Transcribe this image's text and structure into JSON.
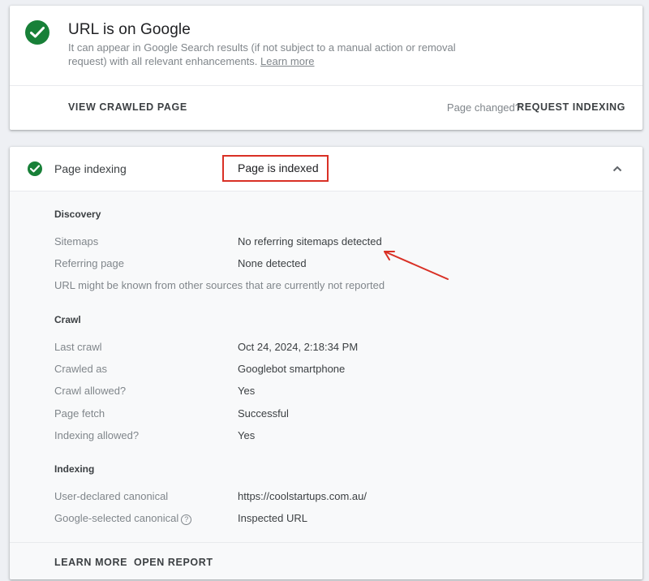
{
  "status_card": {
    "title": "URL is on Google",
    "description": "It can appear in Google Search results (if not subject to a manual action or removal request) with all relevant enhancements.",
    "learn_more_link": "Learn more",
    "view_crawled_label": "VIEW CRAWLED PAGE",
    "page_changed_label": "Page changed?",
    "request_indexing_label": "REQUEST INDEXING"
  },
  "indexing_card": {
    "title": "Page indexing",
    "status": "Page is indexed",
    "discovery": {
      "heading": "Discovery",
      "sitemaps_label": "Sitemaps",
      "sitemaps_value": "No referring sitemaps detected",
      "referring_label": "Referring page",
      "referring_value": "None detected",
      "note": "URL might be known from other sources that are currently not reported"
    },
    "crawl": {
      "heading": "Crawl",
      "last_crawl_label": "Last crawl",
      "last_crawl_value": "Oct 24, 2024, 2:18:34 PM",
      "crawled_as_label": "Crawled as",
      "crawled_as_value": "Googlebot smartphone",
      "crawl_allowed_label": "Crawl allowed?",
      "crawl_allowed_value": "Yes",
      "page_fetch_label": "Page fetch",
      "page_fetch_value": "Successful",
      "indexing_allowed_label": "Indexing allowed?",
      "indexing_allowed_value": "Yes"
    },
    "indexing": {
      "heading": "Indexing",
      "user_canonical_label": "User-declared canonical",
      "user_canonical_value": "https://coolstartups.com.au/",
      "google_canonical_label": "Google-selected canonical",
      "google_canonical_value": "Inspected URL",
      "help_glyph": "?"
    },
    "learn_more_label": "LEARN MORE",
    "open_report_label": "OPEN REPORT"
  },
  "colors": {
    "success_green": "#188038",
    "annotation_red": "#d93025",
    "background": "#eef0f4"
  }
}
